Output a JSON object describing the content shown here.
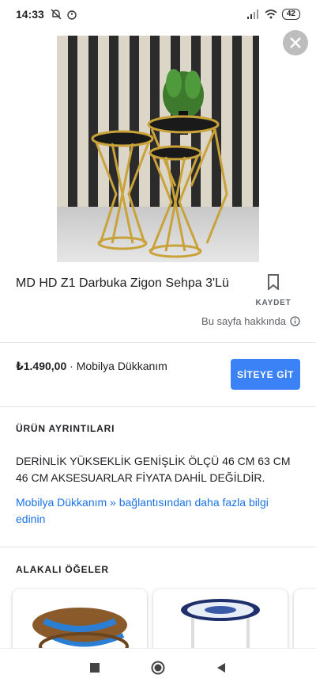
{
  "status_bar": {
    "time": "14:33",
    "battery": "42"
  },
  "product": {
    "title": "MD HD Z1 Darbuka Zigon Sehpa 3'Lü",
    "save_label": "KAYDET",
    "about_label": "Bu sayfa hakkında",
    "price": "₺1.490,00",
    "merchant": "· Mobilya Dükkanım",
    "visit_label": "SİTEYE GİT"
  },
  "details": {
    "heading": "ÜRÜN AYRINTILARI",
    "description": "DERİNLİK YÜKSEKLİK GENİŞLİK ÖLÇÜ 46 CM 63 CM 46 CM AKSESUARLAR FİYATA DAHİL DEĞİLDİR.",
    "more_link": "Mobilya Dükkanım » bağlantısından daha fazla bilgi edinin"
  },
  "related": {
    "heading": "ALAKALI ÖĞELER"
  },
  "colors": {
    "accent": "#3b82f6",
    "link": "#1a73e8",
    "gold": "#c9a23a"
  },
  "icons": [
    "close-icon",
    "bookmark-icon",
    "info-icon",
    "square-nav-icon",
    "circle-nav-icon",
    "back-nav-icon"
  ]
}
